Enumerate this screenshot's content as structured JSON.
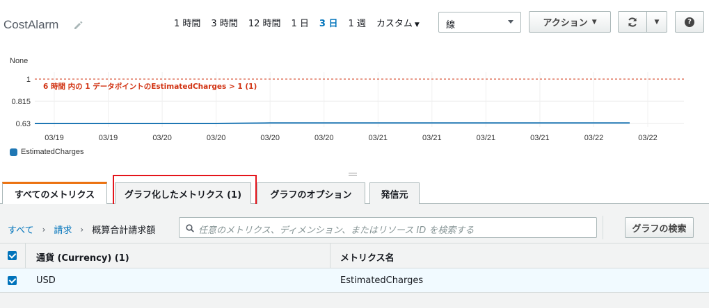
{
  "header": {
    "title": "CostAlarm",
    "time_ranges": [
      {
        "label": "1 時間",
        "active": false
      },
      {
        "label": "3 時間",
        "active": false
      },
      {
        "label": "12 時間",
        "active": false
      },
      {
        "label": "1 日",
        "active": false
      },
      {
        "label": "3 日",
        "active": true
      },
      {
        "label": "1 週",
        "active": false
      },
      {
        "label": "カスタム",
        "active": false
      }
    ],
    "chart_type_select": "線",
    "action_button": "アクション"
  },
  "chart_data": {
    "type": "line",
    "ylabel": "None",
    "yticks": [
      "1",
      "0.815",
      "0.63"
    ],
    "ylim": [
      0.63,
      1
    ],
    "x": [
      "03/19",
      "03/19",
      "03/20",
      "03/20",
      "03/20",
      "03/20",
      "03/21",
      "03/21",
      "03/21",
      "03/21",
      "03/22",
      "03/22"
    ],
    "series": [
      {
        "name": "EstimatedCharges",
        "values": [
          0.63,
          0.63,
          0.63,
          0.63,
          0.634,
          0.634,
          0.634,
          0.634,
          0.634,
          0.634,
          0.634,
          0.634
        ],
        "color": "#1f77b4"
      }
    ],
    "threshold": {
      "value": 1,
      "label": "6 時間 内の 1 データポイントのEstimatedCharges > 1 (1)",
      "color": "#d13212"
    },
    "grid": true,
    "legend": "bottom-left"
  },
  "tabs": [
    {
      "label": "すべてのメトリクス",
      "active": true
    },
    {
      "label": "グラフ化したメトリクス (1)",
      "active": false
    },
    {
      "label": "グラフのオプション",
      "active": false
    },
    {
      "label": "発信元",
      "active": false
    }
  ],
  "breadcrumb": {
    "items": [
      "すべて",
      "請求"
    ],
    "current": "概算合計請求額"
  },
  "search": {
    "placeholder": "任意のメトリクス、ディメンション、またはリソース ID を検索する",
    "button": "グラフの検索"
  },
  "table": {
    "columns": [
      "通貨 (Currency) (1)",
      "メトリクス名"
    ],
    "rows": [
      {
        "currency": "USD",
        "metric": "EstimatedCharges",
        "checked": true
      }
    ]
  }
}
